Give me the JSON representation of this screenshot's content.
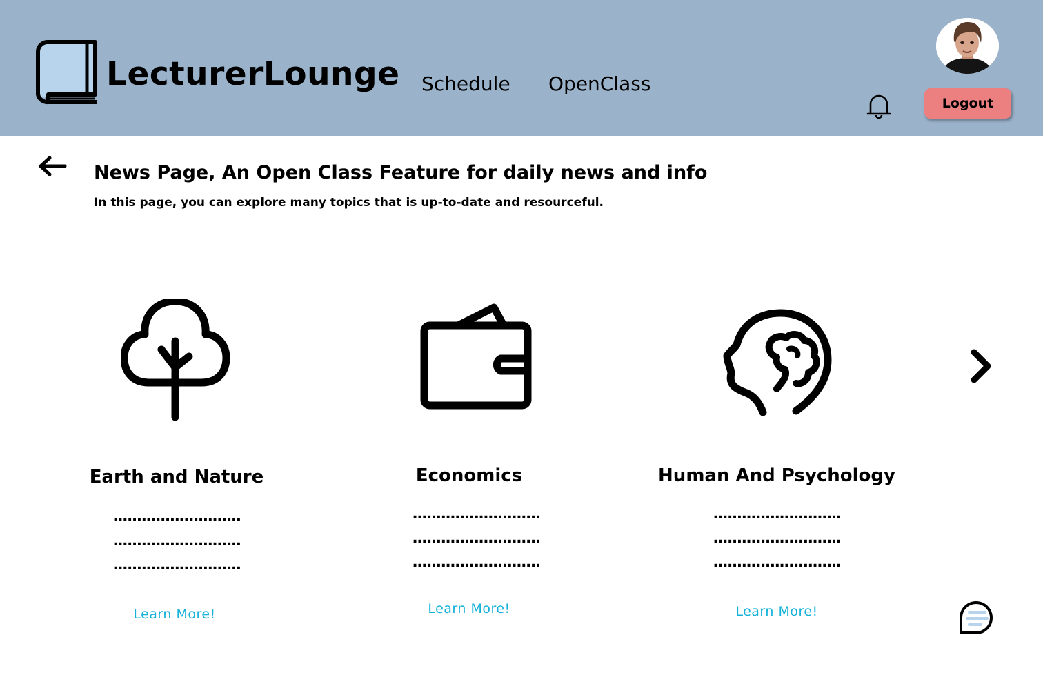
{
  "header": {
    "brand": "LecturerLounge",
    "nav": [
      {
        "label": "Schedule"
      },
      {
        "label": "OpenClass"
      }
    ],
    "logout_label": "Logout",
    "colors": {
      "background": "#9ab3cb",
      "logout": "#ec7f7f"
    }
  },
  "page": {
    "title": "News Page, An Open Class Feature for daily news and info",
    "subtitle": "In this page, you can explore many topics that is up-to-date and resourceful."
  },
  "topics": [
    {
      "name": "Earth and Nature",
      "icon": "tree-icon",
      "lines": [
        "...........................",
        "...........................",
        "..........................."
      ],
      "link": "Learn More!"
    },
    {
      "name": "Economics",
      "icon": "wallet-icon",
      "lines": [
        "...........................",
        "...........................",
        "..........................."
      ],
      "link": "Learn More!"
    },
    {
      "name": "Human And Psychology",
      "icon": "head-brain-icon",
      "lines": [
        "...........................",
        "...........................",
        "..........................."
      ],
      "link": "Learn More!"
    }
  ],
  "icons": {
    "logo": "book-icon",
    "notifications": "bell-icon",
    "back": "arrow-left-icon",
    "next": "chevron-right-icon",
    "chat": "chat-bubble-icon"
  },
  "colors": {
    "link": "#14b1d8"
  }
}
